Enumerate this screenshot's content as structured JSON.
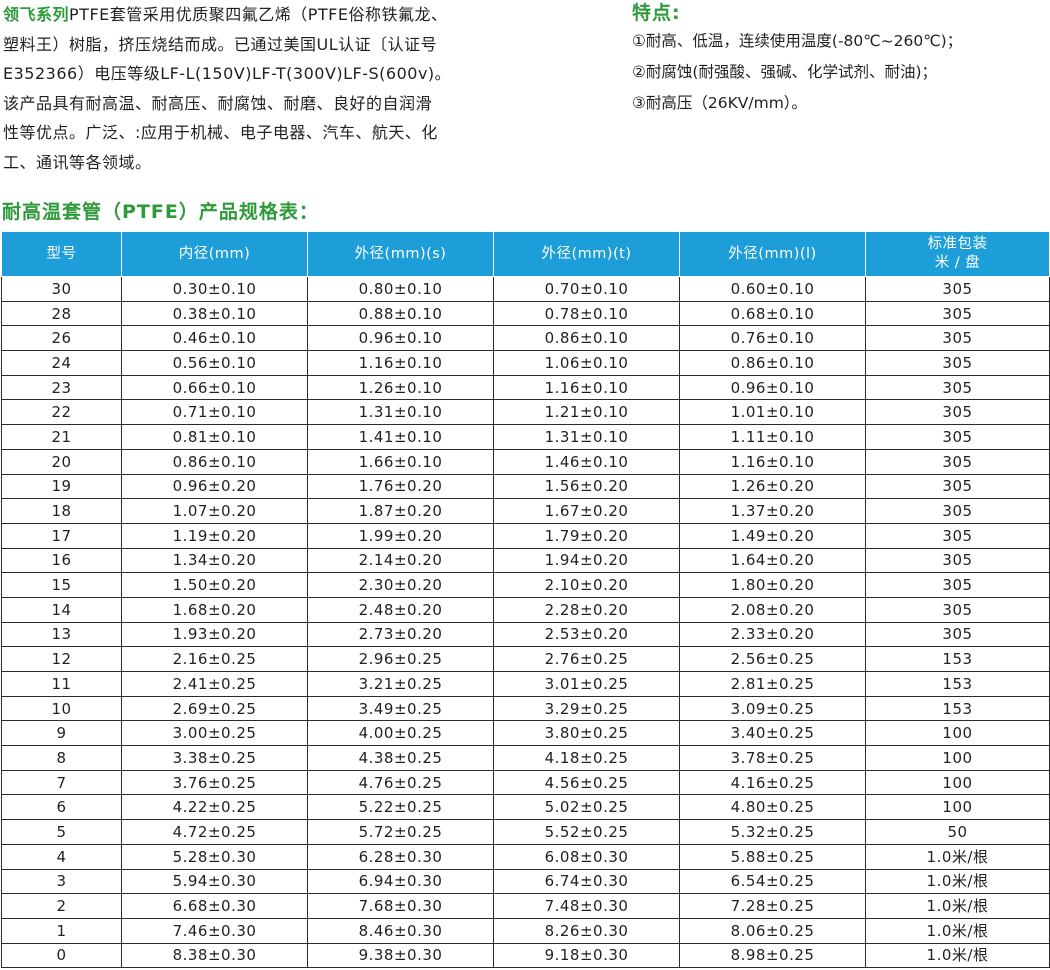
{
  "intro": {
    "brand": "领飞系列",
    "lines": [
      "PTFE套管采用优质聚四氟乙烯（PTFE俗称铁氟龙、",
      "塑料王）树脂，挤压烧结而成。已通过美国UL认证〔认证号",
      "E352366）电压等级LF-L(150V)LF-T(300V)LF-S(600v)。",
      "该产品具有耐高温、耐高压、耐腐蚀、耐磨、良好的自润滑",
      "性等优点。广泛、:应用于机械、电子电器、汽车、航天、化",
      "工、通讯等各领域。"
    ]
  },
  "features": {
    "title": "特点:",
    "items": [
      "①耐高、低温，连续使用温度(-80℃~260℃)；",
      "②耐腐蚀(耐强酸、强碱、化学试剂、耐油)；",
      "③耐高压（26KV/mm）。"
    ]
  },
  "table": {
    "title": "耐高温套管（PTFE）产品规格表：",
    "headers": [
      "型号",
      "内径(mm)",
      "外径(mm)(s)",
      "外径(mm)(t)",
      "外径(mm)(l)",
      "标准包装",
      "米 / 盘"
    ],
    "rows": [
      [
        "30",
        "0.30±0.10",
        "0.80±0.10",
        "0.70±0.10",
        "0.60±0.10",
        "305"
      ],
      [
        "28",
        "0.38±0.10",
        "0.88±0.10",
        "0.78±0.10",
        "0.68±0.10",
        "305"
      ],
      [
        "26",
        "0.46±0.10",
        "0.96±0.10",
        "0.86±0.10",
        "0.76±0.10",
        "305"
      ],
      [
        "24",
        "0.56±0.10",
        "1.16±0.10",
        "1.06±0.10",
        "0.86±0.10",
        "305"
      ],
      [
        "23",
        "0.66±0.10",
        "1.26±0.10",
        "1.16±0.10",
        "0.96±0.10",
        "305"
      ],
      [
        "22",
        "0.71±0.10",
        "1.31±0.10",
        "1.21±0.10",
        "1.01±0.10",
        "305"
      ],
      [
        "21",
        "0.81±0.10",
        "1.41±0.10",
        "1.31±0.10",
        "1.11±0.10",
        "305"
      ],
      [
        "20",
        "0.86±0.10",
        "1.66±0.10",
        "1.46±0.10",
        "1.16±0.10",
        "305"
      ],
      [
        "19",
        "0.96±0.20",
        "1.76±0.20",
        "1.56±0.20",
        "1.26±0.20",
        "305"
      ],
      [
        "18",
        "1.07±0.20",
        "1.87±0.20",
        "1.67±0.20",
        "1.37±0.20",
        "305"
      ],
      [
        "17",
        "1.19±0.20",
        "1.99±0.20",
        "1.79±0.20",
        "1.49±0.20",
        "305"
      ],
      [
        "16",
        "1.34±0.20",
        "2.14±0.20",
        "1.94±0.20",
        "1.64±0.20",
        "305"
      ],
      [
        "15",
        "1.50±0.20",
        "2.30±0.20",
        "2.10±0.20",
        "1.80±0.20",
        "305"
      ],
      [
        "14",
        "1.68±0.20",
        "2.48±0.20",
        "2.28±0.20",
        "2.08±0.20",
        "305"
      ],
      [
        "13",
        "1.93±0.20",
        "2.73±0.20",
        "2.53±0.20",
        "2.33±0.20",
        "305"
      ],
      [
        "12",
        "2.16±0.25",
        "2.96±0.25",
        "2.76±0.25",
        "2.56±0.25",
        "153"
      ],
      [
        "11",
        "2.41±0.25",
        "3.21±0.25",
        "3.01±0.25",
        "2.81±0.25",
        "153"
      ],
      [
        "10",
        "2.69±0.25",
        "3.49±0.25",
        "3.29±0.25",
        "3.09±0.25",
        "153"
      ],
      [
        "9",
        "3.00±0.25",
        "4.00±0.25",
        "3.80±0.25",
        "3.40±0.25",
        "100"
      ],
      [
        "8",
        "3.38±0.25",
        "4.38±0.25",
        "4.18±0.25",
        "3.78±0.25",
        "100"
      ],
      [
        "7",
        "3.76±0.25",
        "4.76±0.25",
        "4.56±0.25",
        "4.16±0.25",
        "100"
      ],
      [
        "6",
        "4.22±0.25",
        "5.22±0.25",
        "5.02±0.25",
        "4.80±0.25",
        "100"
      ],
      [
        "5",
        "4.72±0.25",
        "5.72±0.25",
        "5.52±0.25",
        "5.32±0.25",
        "50"
      ],
      [
        "4",
        "5.28±0.30",
        "6.28±0.30",
        "6.08±0.30",
        "5.88±0.25",
        "1.0米/根"
      ],
      [
        "3",
        "5.94±0.30",
        "6.94±0.30",
        "6.74±0.30",
        "6.54±0.25",
        "1.0米/根"
      ],
      [
        "2",
        "6.68±0.30",
        "7.68±0.30",
        "7.48±0.30",
        "7.28±0.25",
        "1.0米/根"
      ],
      [
        "1",
        "7.46±0.30",
        "8.46±0.30",
        "8.26±0.30",
        "8.06±0.25",
        "1.0米/根"
      ],
      [
        "0",
        "8.38±0.30",
        "9.38±0.30",
        "9.18±0.30",
        "8.98±0.25",
        "1.0米/根"
      ]
    ]
  }
}
